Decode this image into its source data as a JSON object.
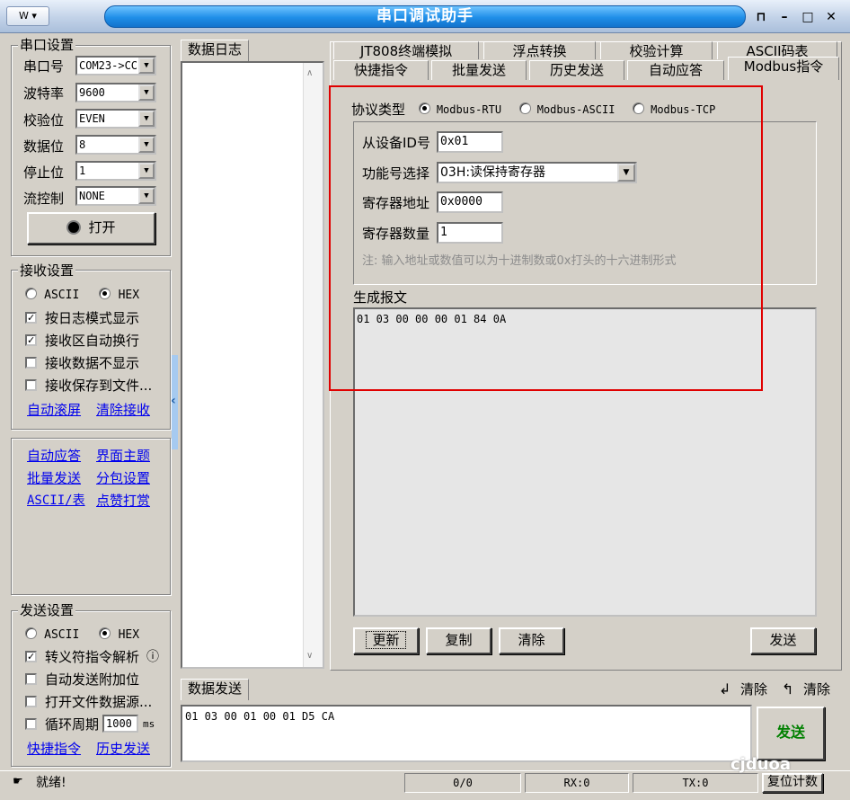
{
  "window": {
    "title": "串口调试助手",
    "sysmenu_label": "W ▾",
    "min": "–",
    "max": "□",
    "close": "✕",
    "pin": "⊓"
  },
  "serial": {
    "group_title": "串口设置",
    "port_label": "串口号",
    "port_value": "COM23->CC",
    "baud_label": "波特率",
    "baud_value": "9600",
    "parity_label": "校验位",
    "parity_value": "EVEN",
    "databits_label": "数据位",
    "databits_value": "8",
    "stopbits_label": "停止位",
    "stopbits_value": "1",
    "flow_label": "流控制",
    "flow_value": "NONE",
    "open_button": "打开"
  },
  "receive": {
    "group_title": "接收设置",
    "ascii": "ASCII",
    "hex": "HEX",
    "log_mode": "按日志模式显示",
    "auto_wrap": "接收区自动换行",
    "hide_data": "接收数据不显示",
    "save_file": "接收保存到文件...",
    "auto_scroll": "自动滚屏",
    "clear_recv": "清除接收"
  },
  "links": {
    "auto_reply": "自动应答",
    "theme": "界面主题",
    "batch_send": "批量发送",
    "packet": "分包设置",
    "ascii_table": "ASCII/表",
    "tip": "点赞打赏"
  },
  "send": {
    "group_title": "发送设置",
    "ascii": "ASCII",
    "hex": "HEX",
    "escape": "转义符指令解析",
    "info_icon": "ⓘ",
    "auto_checksum": "自动发送附加位",
    "open_file": "打开文件数据源...",
    "cycle": "循环周期",
    "cycle_value": "1000",
    "cycle_unit": "ms",
    "quick_cmd": "快捷指令",
    "history": "历史发送"
  },
  "log": {
    "tab": "数据日志"
  },
  "tabs": {
    "row1": [
      "JT808终端模拟",
      "浮点转换",
      "校验计算",
      "ASCII码表"
    ],
    "row2": [
      "快捷指令",
      "批量发送",
      "历史发送",
      "自动应答",
      "Modbus指令"
    ]
  },
  "modbus": {
    "protocol_label": "协议类型",
    "rtu": "Modbus-RTU",
    "ascii": "Modbus-ASCII",
    "tcp": "Modbus-TCP",
    "slave_label": "从设备ID号",
    "slave_value": "0x01",
    "func_label": "功能号选择",
    "func_value": "03H:读保持寄存器",
    "addr_label": "寄存器地址",
    "addr_value": "0x0000",
    "count_label": "寄存器数量",
    "count_value": "1",
    "note": "注: 输入地址或数值可以为十进制数或0x打头的十六进制形式",
    "msg_label": "生成报文",
    "msg_value": "01 03 00 00 00 01 84 0A",
    "update_btn": "更新",
    "copy_btn": "复制",
    "clear_btn": "清除",
    "send_btn": "发送"
  },
  "datasend": {
    "tab": "数据发送",
    "clear1": "清除",
    "clear2": "清除",
    "value": "01 03 00 01 00 01 D5 CA",
    "send_btn": "发送"
  },
  "status": {
    "ready": "就绪!",
    "count": "0/0",
    "rx": "RX:0",
    "tx": "TX:0",
    "reset": "复位计数",
    "watermark": "cjduoa"
  },
  "colors": {
    "accent_red": "#e00000",
    "send_green": "#008000",
    "title_blue": "#1f8ee8"
  }
}
